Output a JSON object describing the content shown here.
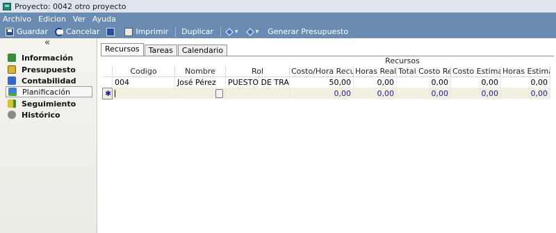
{
  "window": {
    "title": "Proyecto: 0042 otro proyecto"
  },
  "menu": [
    "Archivo",
    "Edicion",
    "Ver",
    "Ayuda"
  ],
  "toolbar": {
    "save": "Guardar",
    "cancel": "Cancelar",
    "print": "Imprimir",
    "duplicate": "Duplicar",
    "generate_budget": "Generar Presupuesto"
  },
  "sidebar": {
    "collapse_glyph": "«",
    "items": [
      {
        "label": "Información",
        "icon": "info-icon"
      },
      {
        "label": "Presupuesto",
        "icon": "budget-icon"
      },
      {
        "label": "Contabilidad",
        "icon": "accounting-icon"
      },
      {
        "label": "Planificación",
        "icon": "planning-icon",
        "selected": true
      },
      {
        "label": "Seguimiento",
        "icon": "tracking-icon"
      },
      {
        "label": "Histórico",
        "icon": "history-icon"
      }
    ]
  },
  "tabs": [
    "Recursos",
    "Tareas",
    "Calendario"
  ],
  "grid": {
    "group_header": "Recursos",
    "columns": [
      "Codigo",
      "Nombre",
      "Rol",
      "Costo/Hora Recurso",
      "Horas Reales",
      "Total Costo Real",
      "Costo Estimado",
      "Horas Estimadas"
    ],
    "rows": [
      [
        "004",
        "José Pérez",
        "PUESTO DE TRABAJO",
        "50,00",
        "0,00",
        "0,00",
        "0,00",
        "0,00"
      ]
    ],
    "new_row": {
      "marker": "✱",
      "values": [
        "",
        "",
        "",
        "0,00",
        "0,00",
        "0,00",
        "0,00",
        "0,00"
      ]
    }
  }
}
